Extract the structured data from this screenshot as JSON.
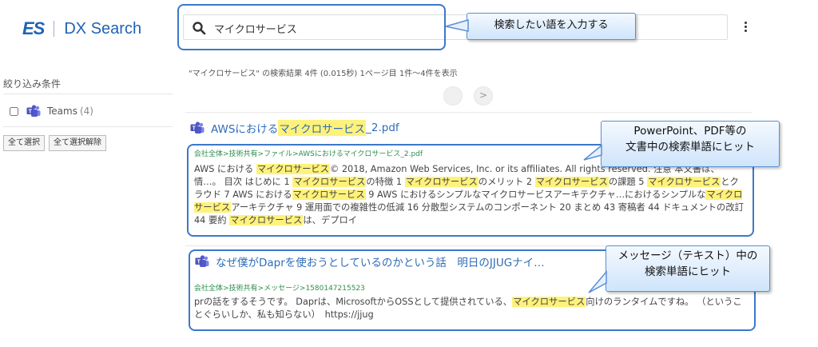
{
  "logo": {
    "mark": "ES",
    "name": "DX Search"
  },
  "search": {
    "value": "マイクロサービス"
  },
  "sidebar": {
    "filter_title": "絞り込み条件",
    "filters": [
      {
        "label": "Teams",
        "count": "(4)"
      }
    ],
    "select_all": "全て選択",
    "deselect_all": "全て選択解除"
  },
  "results_summary": "\"マイクロサービス\" の検索結果 4件 (0.015秒) 1ページ目 1件〜4件を表示",
  "pager": {
    "next": ">"
  },
  "callouts": {
    "search": "検索したい語を入力する",
    "pdf_line1": "PowerPoint、PDF等の",
    "pdf_line2": "文書中の検索単語にヒット",
    "msg_line1": "メッセージ（テキスト）中の",
    "msg_line2": "検索単語にヒット"
  },
  "results": [
    {
      "title_pre": "AWSにおける",
      "title_hl": "マイクロサービス",
      "title_post": "_2.pdf",
      "path": "会社全体>技術共有>ファイル>AWSにおけるマイクロサービス_2.pdf",
      "snippet": [
        {
          "t": "AWS における "
        },
        {
          "h": "マイクロサービス"
        },
        {
          "t": "© 2018, Amazon Web Services, Inc. or its affiliates. All rights reserved. 注意 本文書は、情…。 目次 はじめに 1 "
        },
        {
          "h": "マイクロサービス"
        },
        {
          "t": "の特徴 1 "
        },
        {
          "h": "マイクロサービス"
        },
        {
          "t": "のメリット 2 "
        },
        {
          "h": "マイクロサービス"
        },
        {
          "t": "の課題 5 "
        },
        {
          "h": "マイクロサービス"
        },
        {
          "t": "とクラウド 7 AWS における"
        },
        {
          "h": "マイクロサービス"
        },
        {
          "t": " 9 AWS におけるシンプルなマイクロサービスアーキテクチャ…におけるシンプルな"
        },
        {
          "h": "マイクロサービス"
        },
        {
          "t": "アーキテクチャ 9 運用面での複雑性の低減 16 分散型システムのコンポーネント 20 まとめ 43 寄稿者 44 ドキュメントの改訂 44 要約 "
        },
        {
          "h": "マイクロサービス"
        },
        {
          "t": "は、デプロイ"
        }
      ]
    },
    {
      "title": "なぜ僕がDaprを使おうとしているのかという話　明日のJJUGナイ…",
      "path": "会社全体>技術共有>メッセージ>1580147215523",
      "snippet": [
        {
          "t": "prの話をするそうです。 Daprは、MicrosoftからOSSとして提供されている、"
        },
        {
          "h": "マイクロサービス"
        },
        {
          "t": "向けのランタイムですね。 （ということぐらいしか、私も知らない）　https://jjug"
        }
      ]
    }
  ],
  "colors": {
    "accent": "#1f63b4",
    "link": "#2f6cb8",
    "path": "#2e8f4c",
    "highlight": "#fff27a",
    "frame": "#3c78c8"
  }
}
